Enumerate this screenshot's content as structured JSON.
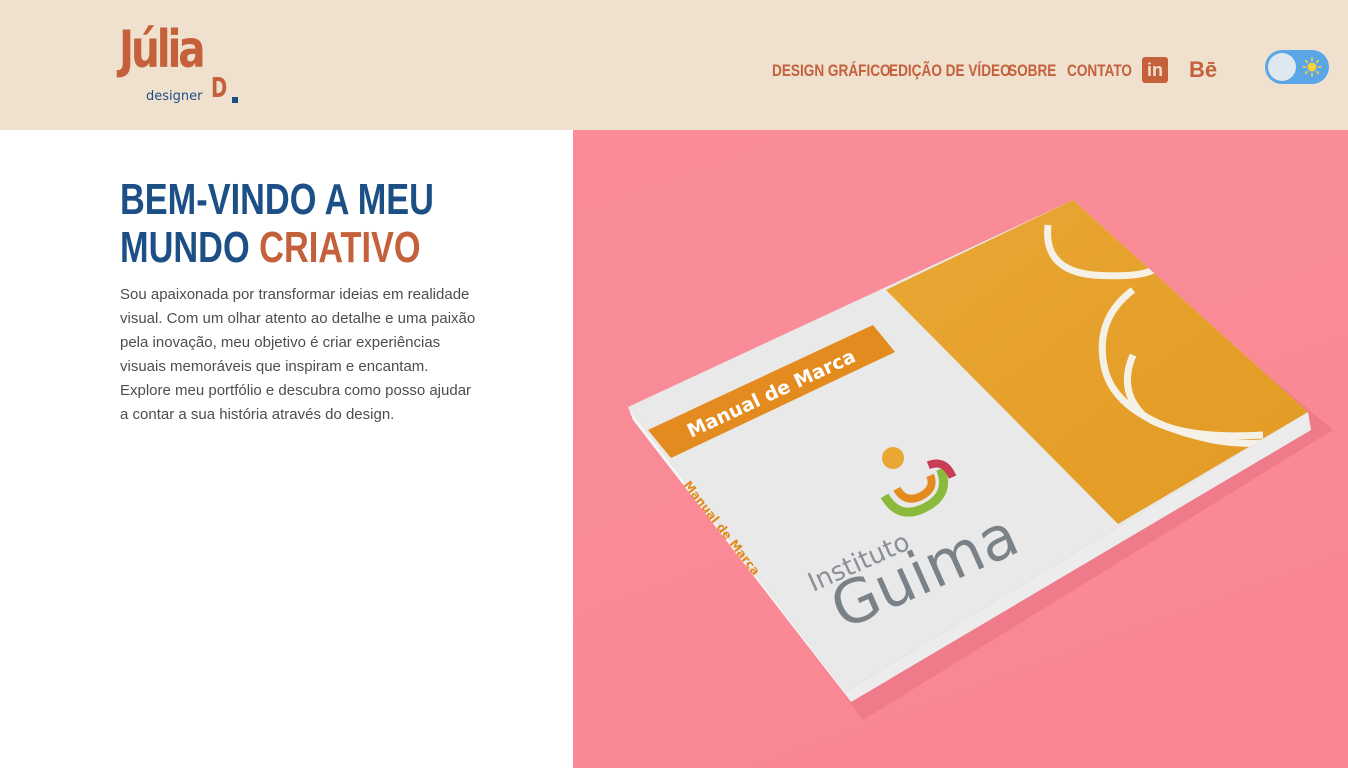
{
  "header": {
    "logo": {
      "main": "Júlia",
      "sub": "designer",
      "initial": "D"
    },
    "nav": [
      {
        "label": "DESIGN GRÁFICO"
      },
      {
        "label": "EDIÇÃO DE VÍDEO"
      },
      {
        "label": "SOBRE"
      },
      {
        "label": "CONTATO"
      }
    ],
    "social": {
      "linkedin": "in",
      "behance": "Bē"
    },
    "theme_toggle": {
      "state": "light"
    }
  },
  "hero": {
    "title_part1": "BEM-VINDO A MEU",
    "title_part2": "MUNDO",
    "title_accent": "CRIATIVO",
    "description": "Sou apaixonada por transformar ideias em realidade visual. Com um olhar atento ao detalhe e uma paixão pela inovação, meu objetivo é criar experiências visuais memoráveis que inspiram e encantam. Explore meu portfólio e descubra como posso ajudar a contar a sua história através do design.",
    "image": {
      "cover_label": "Manual de Marca",
      "spine_label": "Manual de Marca",
      "brand_line1": "Instituto",
      "brand_line2": "Guima"
    }
  },
  "colors": {
    "header_bg": "#f0e1cf",
    "accent": "#c4603a",
    "primary": "#1c4f85",
    "hero_bg": "#fb8b99",
    "toggle": "#5aa6e6"
  }
}
